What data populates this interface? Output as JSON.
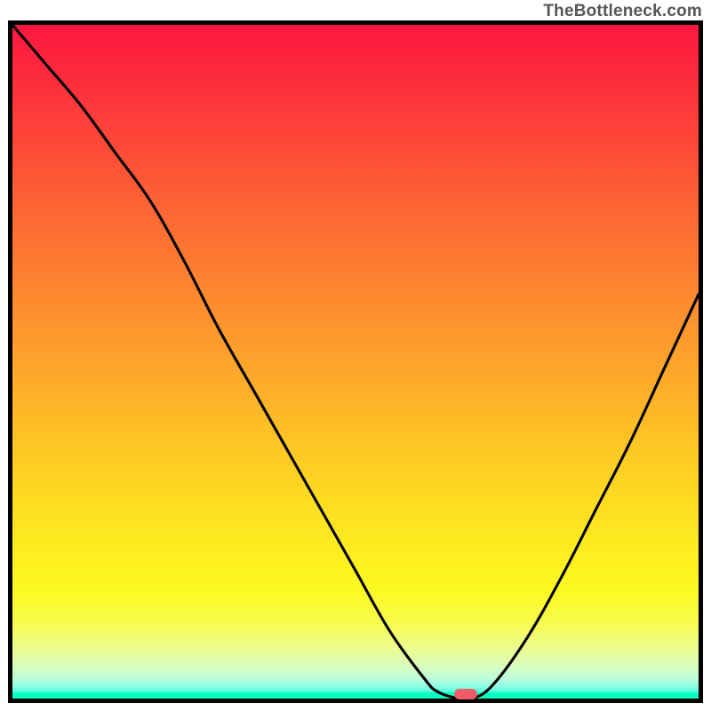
{
  "attribution": "TheBottleneck.com",
  "colors": {
    "frame_border": "#000000",
    "curve_stroke": "#000000",
    "marker_fill": "#f05c6a",
    "gradient_top": "#fd163f",
    "gradient_bottom": "#0afec2"
  },
  "chart_data": {
    "type": "line",
    "title": "",
    "xlabel": "",
    "ylabel": "",
    "xlim": [
      0,
      100
    ],
    "ylim": [
      0,
      100
    ],
    "x": [
      0,
      5,
      10,
      15,
      20,
      25,
      30,
      35,
      40,
      45,
      50,
      55,
      60,
      62,
      65,
      67,
      70,
      75,
      80,
      85,
      90,
      95,
      100
    ],
    "values": [
      100,
      94,
      88,
      81,
      74,
      65,
      55,
      46,
      37,
      28,
      19,
      10,
      3,
      1,
      0,
      0,
      2,
      9,
      18,
      28,
      38,
      49,
      60
    ],
    "optimum_x": 66,
    "flat_region_x": [
      62.5,
      68
    ],
    "grid": false,
    "legend": false,
    "note": "Black curve over red→green vertical gradient; minimum (green zone) near x≈66% with a short flat bottom and a small pink pill marker at the minimum."
  },
  "marker": {
    "x_pct": 66,
    "y_pct": 0
  }
}
